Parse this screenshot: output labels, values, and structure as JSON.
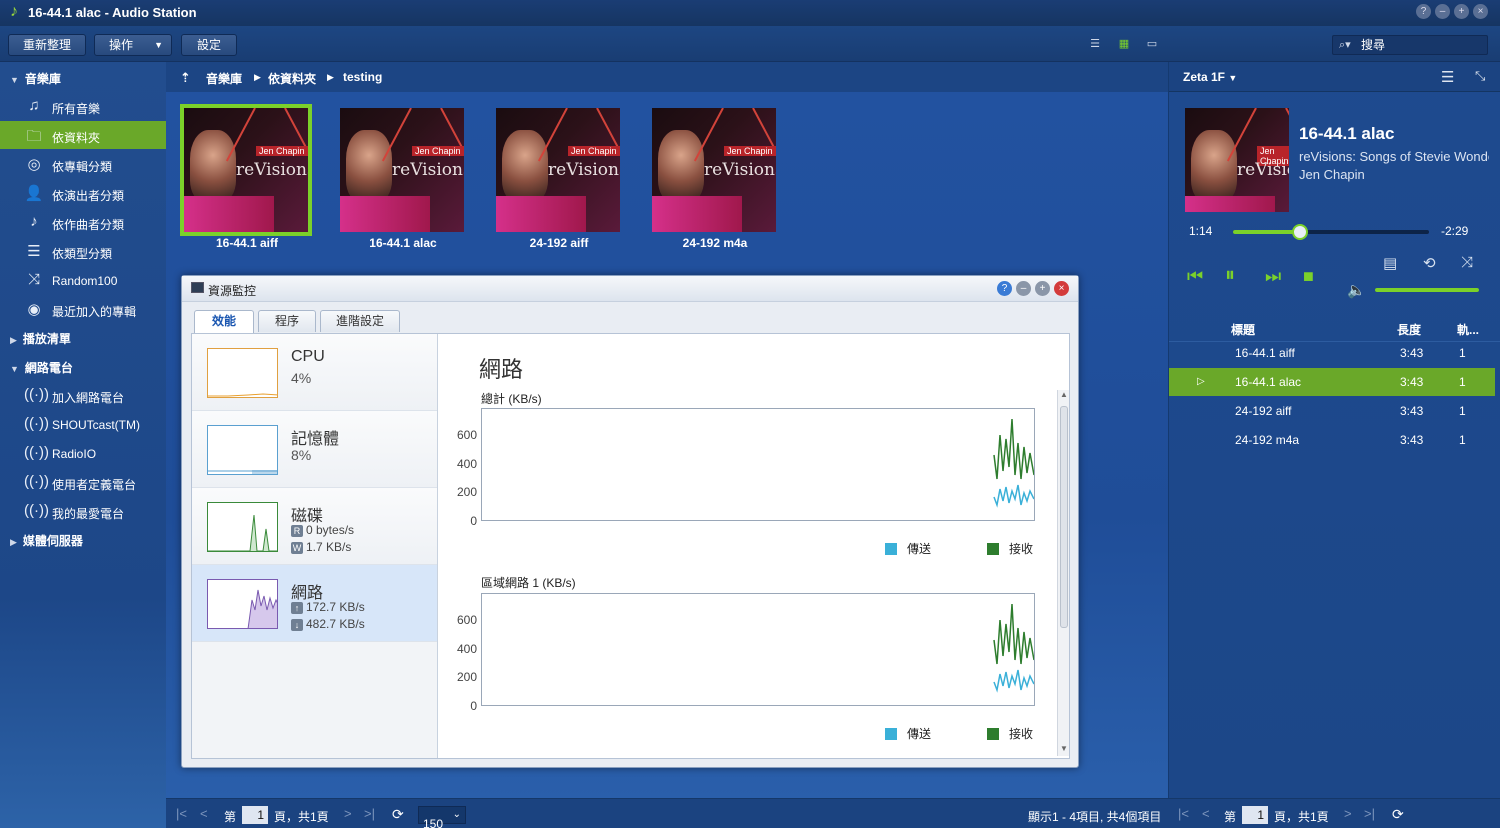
{
  "window": {
    "title": "16-44.1 alac - Audio Station"
  },
  "toolbar": {
    "refresh_label": "重新整理",
    "action_label": "操作",
    "settings_label": "設定",
    "search_placeholder": "搜尋"
  },
  "sidebar": {
    "library_header": "音樂庫",
    "library_items": [
      {
        "label": "所有音樂",
        "icon": "music-note-icon"
      },
      {
        "label": "依資料夾",
        "icon": "folder-icon"
      },
      {
        "label": "依專輯分類",
        "icon": "disc-icon"
      },
      {
        "label": "依演出者分類",
        "icon": "person-icon"
      },
      {
        "label": "依作曲者分類",
        "icon": "composer-note-icon"
      },
      {
        "label": "依類型分類",
        "icon": "list-icon"
      },
      {
        "label": "Random100",
        "icon": "shuffle-icon"
      },
      {
        "label": "最近加入的專輯",
        "icon": "recent-disc-icon"
      }
    ],
    "playlist_header": "播放清單",
    "radio_header": "網路電台",
    "radio_items": [
      {
        "label": "加入網路電台"
      },
      {
        "label": "SHOUTcast(TM)"
      },
      {
        "label": "RadioIO"
      },
      {
        "label": "使用者定義電台"
      },
      {
        "label": "我的最愛電台"
      }
    ],
    "media_server_header": "媒體伺服器"
  },
  "breadcrumb": {
    "items": [
      "音樂庫",
      "依資料夾",
      "testing"
    ]
  },
  "albums": [
    {
      "caption": "16-44.1 aiff",
      "selected": true
    },
    {
      "caption": "16-44.1 alac",
      "selected": false
    },
    {
      "caption": "24-192 aiff",
      "selected": false
    },
    {
      "caption": "24-192 m4a",
      "selected": false
    }
  ],
  "cover_art": {
    "artist": "Jen Chapin",
    "title_re": "re",
    "title_rest": "Visions"
  },
  "resource_monitor": {
    "title": "資源監控",
    "tabs": [
      "效能",
      "程序",
      "進階設定"
    ],
    "active_tab": 0,
    "items": [
      {
        "name": "CPU",
        "value": "4%"
      },
      {
        "name": "記憶體",
        "value": "8%"
      },
      {
        "name": "磁碟",
        "read": "0 bytes/s",
        "write": "1.7 KB/s",
        "read_badge": "R",
        "write_badge": "W"
      },
      {
        "name": "網路",
        "up": "172.7 KB/s",
        "down": "482.7 KB/s"
      }
    ],
    "heading": "網路",
    "charts": [
      {
        "title": "總計 (KB/s)",
        "y_ticks": [
          "600",
          "400",
          "200",
          "0"
        ],
        "legend_send": "傳送",
        "legend_recv": "接收"
      },
      {
        "title": "區域網路 1 (KB/s)",
        "y_ticks": [
          "600",
          "400",
          "200",
          "0"
        ],
        "legend_send": "傳送",
        "legend_recv": "接收"
      }
    ],
    "colors": {
      "send": "#3ab0d8",
      "recv": "#2e7d2e"
    }
  },
  "player": {
    "device": "Zeta 1F",
    "title": "16-44.1 alac",
    "album": "reVisions: Songs of Stevie Wonder",
    "artist": "Jen Chapin",
    "elapsed": "1:14",
    "remaining": "-2:29",
    "progress": 0.34,
    "volume": 1.0
  },
  "playlist": {
    "headers": {
      "title": "標題",
      "length": "長度",
      "track": "軌..."
    },
    "rows": [
      {
        "title": "16-44.1 aiff",
        "length": "3:43",
        "track": "1",
        "playing": false
      },
      {
        "title": "16-44.1 alac",
        "length": "3:43",
        "track": "1",
        "playing": true
      },
      {
        "title": "24-192 aiff",
        "length": "3:43",
        "track": "1",
        "playing": false
      },
      {
        "title": "24-192 m4a",
        "length": "3:43",
        "track": "1",
        "playing": false
      }
    ]
  },
  "pagination": {
    "page_prefix": "第",
    "page": "1",
    "page_suffix": "頁，共1頁",
    "page_size": "150",
    "summary": "顯示1 - 4項目, 共4個項目"
  },
  "accent_color": "#6aa829"
}
